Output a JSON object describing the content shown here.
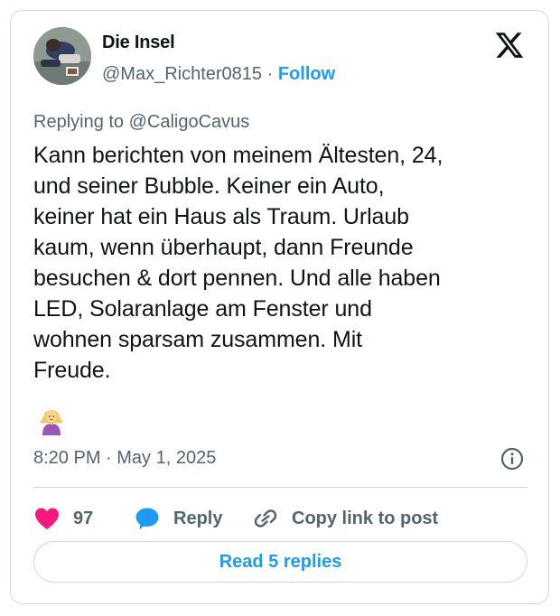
{
  "author": {
    "name": "Die Insel",
    "handle": "@Max_Richter0815",
    "separator": " · ",
    "follow_label": "Follow"
  },
  "icons": {
    "brand": "x-logo-icon",
    "info": "info-icon",
    "like": "heart-icon",
    "reply": "speech-bubble-icon",
    "copy": "link-icon",
    "emoji": "person-shrugging-emoji"
  },
  "tweet": {
    "replying_to": "Replying to @CaligoCavus",
    "text": "Kann berichten von meinem Ältesten, 24,\nund seiner Bubble. Keiner ein Auto,\nkeiner hat ein Haus als Traum. Urlaub\nkaum, wenn überhaupt, dann Freunde\nbesuchen & dort pennen. Und alle haben\nLED, Solaranlage am Fenster und\nwohnen sparsam zusammen. Mit\nFreude.",
    "timestamp": "8:20 PM · May 1, 2025"
  },
  "actions": {
    "like_count": "97",
    "reply_label": "Reply",
    "copy_label": "Copy link to post"
  },
  "read_replies_label": "Read 5 replies",
  "colors": {
    "accent": "#1d9bf0",
    "like": "#f91880",
    "muted": "#536471",
    "text": "#0f1419",
    "border": "#cfd9de"
  }
}
